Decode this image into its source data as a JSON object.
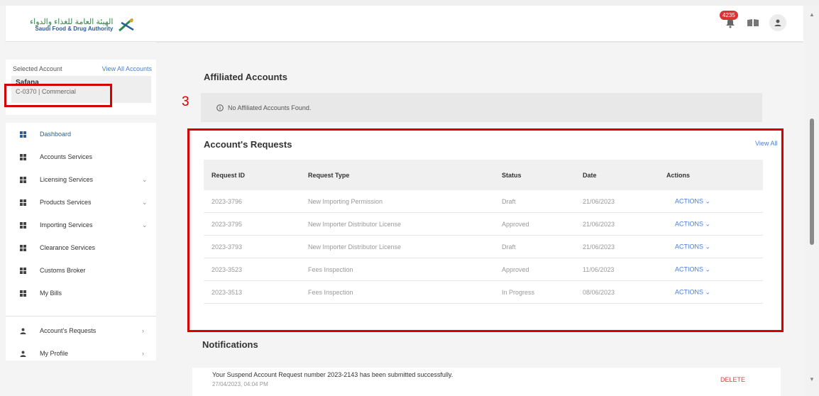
{
  "header": {
    "logo_ar": "الهيئة العامة للغذاء والدواء",
    "logo_en": "Saudi Food & Drug Authority",
    "notification_count": "4235"
  },
  "sidebar": {
    "selected_account_label": "Selected Account",
    "view_all_accounts": "View All Accounts",
    "account_name": "Safana",
    "account_id": "C-0370 | Commercial",
    "items": [
      {
        "label": "Dashboard"
      },
      {
        "label": "Accounts Services"
      },
      {
        "label": "Licensing Services",
        "chevron": "⌄"
      },
      {
        "label": "Products Services",
        "chevron": "⌄"
      },
      {
        "label": "Importing Services",
        "chevron": "⌄"
      },
      {
        "label": "Clearance Services"
      },
      {
        "label": "Customs Broker"
      },
      {
        "label": "My Bills"
      },
      {
        "label": "Account's Requests",
        "chevron": "›"
      },
      {
        "label": "My Profile",
        "chevron": "›"
      }
    ]
  },
  "main": {
    "affiliated_title": "Affiliated Accounts",
    "affiliated_empty": "No Affiliated Accounts Found.",
    "step_number": "3",
    "requests_title": "Account's Requests",
    "view_all": "View All",
    "columns": [
      "Request ID",
      "Request Type",
      "Status",
      "Date",
      "Actions"
    ],
    "rows": [
      {
        "id": "2023-3796",
        "type": "New Importing Permission",
        "status": "Draft",
        "date": "21/06/2023",
        "action": "ACTIONS ⌄"
      },
      {
        "id": "2023-3795",
        "type": "New Importer Distributor License",
        "status": "Approved",
        "date": "21/06/2023",
        "action": "ACTIONS ⌄"
      },
      {
        "id": "2023-3793",
        "type": "New Importer Distributor License",
        "status": "Draft",
        "date": "21/06/2023",
        "action": "ACTIONS ⌄"
      },
      {
        "id": "2023-3523",
        "type": "Fees Inspection",
        "status": "Approved",
        "date": "11/06/2023",
        "action": "ACTIONS ⌄"
      },
      {
        "id": "2023-3513",
        "type": "Fees Inspection",
        "status": "In Progress",
        "date": "08/06/2023",
        "action": "ACTIONS ⌄"
      }
    ],
    "notifications_title": "Notifications",
    "notification": {
      "text": "Your Suspend Account Request number 2023-2143 has been submitted successfully.",
      "time": "27/04/2023, 04:04 PM",
      "delete": "DELETE"
    }
  },
  "colors": {
    "accent_blue": "#4a7fd0",
    "highlight_red": "#d50000",
    "badge_red": "#d93333"
  }
}
